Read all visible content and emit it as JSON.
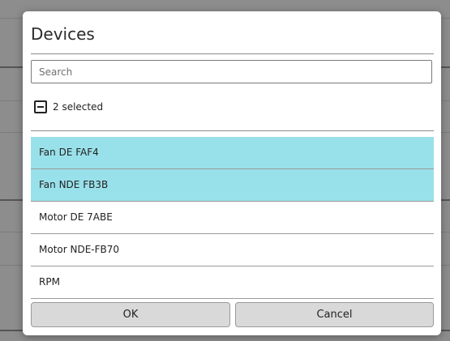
{
  "dialog": {
    "title": "Devices",
    "search_placeholder": "Search",
    "selection_label": "2 selected",
    "items": [
      {
        "label": "Fan DE FAF4",
        "selected": true
      },
      {
        "label": "Fan NDE FB3B",
        "selected": true
      },
      {
        "label": "Motor DE 7ABE",
        "selected": false
      },
      {
        "label": "Motor NDE-FB70",
        "selected": false
      },
      {
        "label": "RPM",
        "selected": false
      }
    ],
    "ok_label": "OK",
    "cancel_label": "Cancel"
  },
  "colors": {
    "selected_row": "#99e1ea",
    "backdrop": "#8d8d8d",
    "button": "#d9d9d9"
  },
  "icons": {
    "select_all": "indeterminate-checkbox-icon"
  }
}
